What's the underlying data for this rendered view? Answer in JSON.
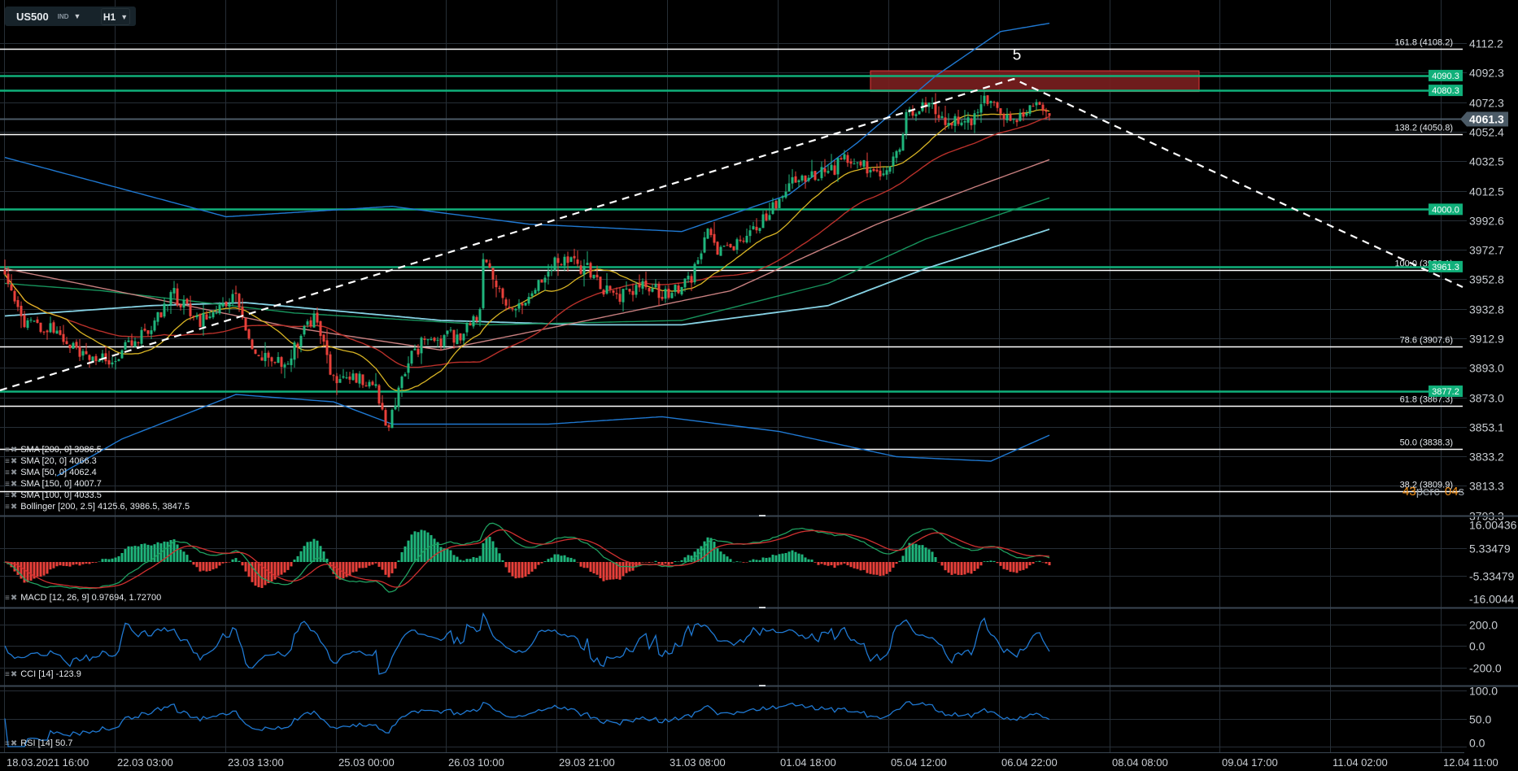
{
  "toolbar": {
    "symbol": "US500",
    "asset_class": "IND",
    "timeframe": "H1"
  },
  "legends": {
    "main": [
      "SMA [200, 0] 3986.5",
      "SMA [20, 0] 4066.3",
      "SMA [50, 0] 4062.4",
      "SMA [150, 0] 4007.7",
      "SMA [100, 0] 4033.5",
      "Bollinger [200, 2.5] 4125.6, 3986.5, 3847.5"
    ],
    "macd": "MACD [12, 26, 9] 0.97694, 1.72700",
    "cci": "CCI [14] -123.9",
    "rsi": "RSI [14] 50.7"
  },
  "countdown": {
    "value1": "43",
    "unit1": "perc",
    "value2": "04",
    "unit2": "s"
  },
  "colors": {
    "bull": "#1fb57c",
    "bear": "#e8403a",
    "level": "#10b07a",
    "bollinger": "#1f78d1",
    "sma20": "#d8b424",
    "sma50": "#b8302a",
    "sma100": "#c98080",
    "sma150": "#17935c",
    "sma200": "#86d2e4",
    "zone": "#7a1f1f",
    "current": "#4b5a66"
  },
  "chart_data": {
    "type": "candlestick",
    "symbol": "US500",
    "timeframe": "H1",
    "price_axis": {
      "ticks": [
        "4112.2",
        "4092.3",
        "4072.3",
        "4052.4",
        "4032.5",
        "4012.5",
        "3992.6",
        "3972.7",
        "3952.8",
        "3932.8",
        "3912.9",
        "3893.0",
        "3873.0",
        "3853.1",
        "3833.2",
        "3813.3",
        "3793.3"
      ]
    },
    "time_axis": {
      "ticks": [
        "18.03.2021  16:00",
        "22.03  03:00",
        "23.03  13:00",
        "25.03  00:00",
        "26.03  10:00",
        "29.03  21:00",
        "31.03  08:00",
        "01.04  18:00",
        "05.04  12:00",
        "06.04  22:00",
        "08.04  08:00",
        "09.04  17:00",
        "11.04  02:00",
        "12.04  11:00"
      ]
    },
    "current_price": "4061.3",
    "levels": [
      {
        "label": "4090.3",
        "price": 4090.3
      },
      {
        "label": "4080.3",
        "price": 4080.3
      },
      {
        "label": "4000.0",
        "price": 4000.0
      },
      {
        "label": "3961.3",
        "price": 3961.3
      },
      {
        "label": "3877.2",
        "price": 3877.2
      }
    ],
    "fibonacci": [
      {
        "label": "161.8 (4108.2)",
        "price": 4108.2
      },
      {
        "label": "138.2 (4050.8)",
        "price": 4050.8
      },
      {
        "label": "100.0 (3959.1)",
        "price": 3959.1
      },
      {
        "label": "78.6 (3907.6)",
        "price": 3907.6
      },
      {
        "label": "61.8 (3867.3)",
        "price": 3867.3
      },
      {
        "label": "50.0 (3838.3)",
        "price": 3838.3
      },
      {
        "label": "38.2 (3809.9)",
        "price": 3809.9
      }
    ],
    "zone": {
      "from_bar": 266,
      "to_bar": 367,
      "top": 4093.5,
      "bottom": 4079.5
    },
    "wave_label": "5",
    "wave_label_at": [
      311,
      4101
    ],
    "trendline": [
      [
        -1.5,
        3877.8
      ],
      [
        310,
        4088
      ],
      [
        448,
        3947.5
      ]
    ],
    "bars": 322,
    "price_keypoints": [
      [
        0,
        3960
      ],
      [
        6,
        3925
      ],
      [
        18,
        3915
      ],
      [
        24,
        3900
      ],
      [
        34,
        3900
      ],
      [
        42,
        3915
      ],
      [
        52,
        3942
      ],
      [
        60,
        3925
      ],
      [
        71,
        3942
      ],
      [
        77,
        3900
      ],
      [
        86,
        3895
      ],
      [
        95,
        3928
      ],
      [
        101,
        3885
      ],
      [
        113,
        3885
      ],
      [
        118,
        3852
      ],
      [
        122,
        3890
      ],
      [
        128,
        3910
      ],
      [
        140,
        3915
      ],
      [
        146,
        3930
      ],
      [
        147,
        3965
      ],
      [
        152,
        3945
      ],
      [
        156,
        3930
      ],
      [
        162,
        3945
      ],
      [
        170,
        3965
      ],
      [
        179,
        3960
      ],
      [
        187,
        3940
      ],
      [
        196,
        3948
      ],
      [
        205,
        3942
      ],
      [
        211,
        3955
      ],
      [
        216,
        3985
      ],
      [
        220,
        3970
      ],
      [
        229,
        3985
      ],
      [
        238,
        4005
      ],
      [
        242,
        4020
      ],
      [
        253,
        4025
      ],
      [
        259,
        4035
      ],
      [
        268,
        4025
      ],
      [
        274,
        4035
      ],
      [
        277,
        4065
      ],
      [
        284,
        4070
      ],
      [
        290,
        4060
      ],
      [
        298,
        4060
      ],
      [
        301,
        4072
      ],
      [
        309,
        4062
      ],
      [
        317,
        4068
      ],
      [
        321,
        4061
      ]
    ],
    "bollinger": {
      "upper": [
        [
          0,
          4035
        ],
        [
          68,
          3995
        ],
        [
          119,
          4002
        ],
        [
          161,
          3990
        ],
        [
          208,
          3985
        ],
        [
          241,
          4010
        ],
        [
          262,
          4045
        ],
        [
          286,
          4090
        ],
        [
          306,
          4120
        ],
        [
          321,
          4125.6
        ]
      ],
      "lower": [
        [
          16,
          3820
        ],
        [
          36,
          3845
        ],
        [
          71,
          3875
        ],
        [
          101,
          3870
        ],
        [
          119,
          3855
        ],
        [
          167,
          3855
        ],
        [
          202,
          3860
        ],
        [
          238,
          3850
        ],
        [
          274,
          3833
        ],
        [
          303,
          3830
        ],
        [
          321,
          3847.5
        ]
      ]
    },
    "sma_keypoints": {
      "sma200": [
        [
          0,
          3928
        ],
        [
          45,
          3935
        ],
        [
          74,
          3937
        ],
        [
          134,
          3925
        ],
        [
          179,
          3922
        ],
        [
          208,
          3922
        ],
        [
          253,
          3935
        ],
        [
          283,
          3960
        ],
        [
          321,
          3986.5
        ]
      ],
      "sma150": [
        [
          0,
          3950
        ],
        [
          30,
          3945
        ],
        [
          89,
          3930
        ],
        [
          149,
          3922
        ],
        [
          208,
          3925
        ],
        [
          253,
          3950
        ],
        [
          283,
          3980
        ],
        [
          321,
          4007.7
        ]
      ],
      "sma100": [
        [
          0,
          3960
        ],
        [
          45,
          3940
        ],
        [
          89,
          3920
        ],
        [
          134,
          3905
        ],
        [
          179,
          3925
        ],
        [
          223,
          3945
        ],
        [
          268,
          3990
        ],
        [
          298,
          4015
        ],
        [
          321,
          4033.5
        ]
      ]
    },
    "macd_axis": {
      "ticks": [
        "16.00436",
        "5.33479",
        "-5.33479",
        "-16.0044"
      ],
      "values": [
        16.00436,
        5.33479,
        -5.33479,
        -16.0044
      ]
    },
    "cci_axis": {
      "ticks": [
        "200.0",
        "0.0",
        "-200.0"
      ],
      "values": [
        200,
        0,
        -200
      ]
    },
    "rsi_axis": {
      "ticks": [
        "100.0",
        "50.0",
        "0.0"
      ],
      "values": [
        100,
        50,
        0
      ]
    }
  }
}
